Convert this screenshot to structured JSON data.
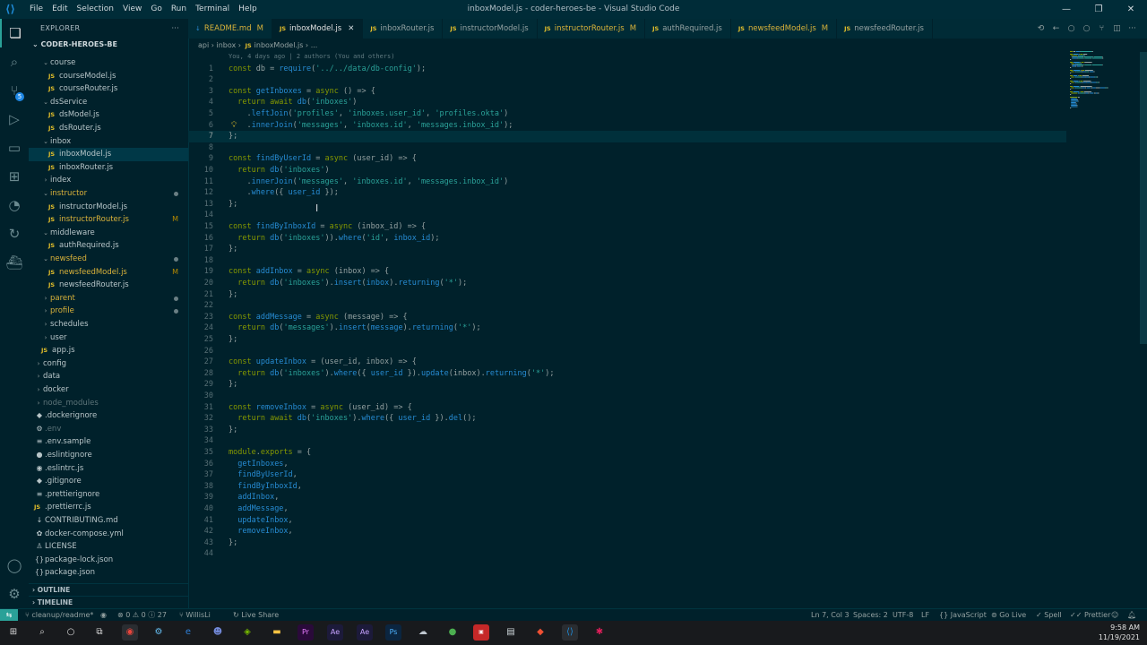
{
  "window": {
    "title": "inboxModel.js - coder-heroes-be - Visual Studio Code",
    "menu": [
      "File",
      "Edit",
      "Selection",
      "View",
      "Go",
      "Run",
      "Terminal",
      "Help"
    ]
  },
  "sidebar": {
    "header": "EXPLORER",
    "project": "CODER-HEROES-BE",
    "tree": [
      {
        "label": "course",
        "type": "folder",
        "depth": 1,
        "open": true
      },
      {
        "label": "courseModel.js",
        "type": "js",
        "depth": 2
      },
      {
        "label": "courseRouter.js",
        "type": "js",
        "depth": 2
      },
      {
        "label": "dsService",
        "type": "folder",
        "depth": 1,
        "open": true
      },
      {
        "label": "dsModel.js",
        "type": "js",
        "depth": 2
      },
      {
        "label": "dsRouter.js",
        "type": "js",
        "depth": 2
      },
      {
        "label": "inbox",
        "type": "folder",
        "depth": 1,
        "open": true
      },
      {
        "label": "inboxModel.js",
        "type": "js",
        "depth": 2,
        "selected": true
      },
      {
        "label": "inboxRouter.js",
        "type": "js",
        "depth": 2
      },
      {
        "label": "index",
        "type": "folder",
        "depth": 1,
        "open": false
      },
      {
        "label": "instructor",
        "type": "folder",
        "depth": 1,
        "open": true,
        "modified": true,
        "dot": true
      },
      {
        "label": "instructorModel.js",
        "type": "js",
        "depth": 2
      },
      {
        "label": "instructorRouter.js",
        "type": "js",
        "depth": 2,
        "modified": true,
        "marker": "M"
      },
      {
        "label": "middleware",
        "type": "folder",
        "depth": 1,
        "open": true
      },
      {
        "label": "authRequired.js",
        "type": "js",
        "depth": 2
      },
      {
        "label": "newsfeed",
        "type": "folder",
        "depth": 1,
        "open": true,
        "modified": true,
        "dot": true
      },
      {
        "label": "newsfeedModel.js",
        "type": "js",
        "depth": 2,
        "modified": true,
        "marker": "M"
      },
      {
        "label": "newsfeedRouter.js",
        "type": "js",
        "depth": 2
      },
      {
        "label": "parent",
        "type": "folder",
        "depth": 1,
        "open": false,
        "modified": true,
        "dot": true
      },
      {
        "label": "profile",
        "type": "folder",
        "depth": 1,
        "open": false,
        "modified": true,
        "dot": true
      },
      {
        "label": "schedules",
        "type": "folder",
        "depth": 1,
        "open": false
      },
      {
        "label": "user",
        "type": "folder",
        "depth": 1,
        "open": false
      },
      {
        "label": "app.js",
        "type": "js",
        "depth": 1
      },
      {
        "label": "config",
        "type": "folder",
        "depth": 0,
        "open": false
      },
      {
        "label": "data",
        "type": "folder",
        "depth": 0,
        "open": false
      },
      {
        "label": "docker",
        "type": "folder",
        "depth": 0,
        "open": false
      },
      {
        "label": "node_modules",
        "type": "folder",
        "depth": 0,
        "open": false,
        "ignored": true
      },
      {
        "label": ".dockerignore",
        "type": "file",
        "depth": 0,
        "glyph": "◆"
      },
      {
        "label": ".env",
        "type": "file",
        "depth": 0,
        "glyph": "⚙",
        "ignored": true
      },
      {
        "label": ".env.sample",
        "type": "file",
        "depth": 0,
        "glyph": "≡"
      },
      {
        "label": ".eslintignore",
        "type": "file",
        "depth": 0,
        "glyph": "●"
      },
      {
        "label": ".eslintrc.js",
        "type": "file",
        "depth": 0,
        "glyph": "◉"
      },
      {
        "label": ".gitignore",
        "type": "file",
        "depth": 0,
        "glyph": "◆"
      },
      {
        "label": ".prettierignore",
        "type": "file",
        "depth": 0,
        "glyph": "≡"
      },
      {
        "label": ".prettierrc.js",
        "type": "js",
        "depth": 0
      },
      {
        "label": "CONTRIBUTING.md",
        "type": "file",
        "depth": 0,
        "glyph": "↓"
      },
      {
        "label": "docker-compose.yml",
        "type": "file",
        "depth": 0,
        "glyph": "✿"
      },
      {
        "label": "LICENSE",
        "type": "file",
        "depth": 0,
        "glyph": "♙"
      },
      {
        "label": "package-lock.json",
        "type": "file",
        "depth": 0,
        "glyph": "{}"
      },
      {
        "label": "package.json",
        "type": "file",
        "depth": 0,
        "glyph": "{}"
      }
    ],
    "outline": "OUTLINE",
    "timeline": "TIMELINE"
  },
  "tabs": [
    {
      "label": "README.md",
      "kind": "md",
      "marker": "M",
      "modified": true
    },
    {
      "label": "inboxModel.js",
      "kind": "js",
      "active": true,
      "close": "✕"
    },
    {
      "label": "inboxRouter.js",
      "kind": "js"
    },
    {
      "label": "instructorModel.js",
      "kind": "js"
    },
    {
      "label": "instructorRouter.js",
      "kind": "js",
      "marker": "M",
      "modified": true
    },
    {
      "label": "authRequired.js",
      "kind": "js"
    },
    {
      "label": "newsfeedModel.js",
      "kind": "js",
      "marker": "M",
      "modified": true
    },
    {
      "label": "newsfeedRouter.js",
      "kind": "js"
    }
  ],
  "breadcrumb": {
    "parts": [
      "api",
      "inbox",
      "inboxModel.js",
      "..."
    ]
  },
  "blame": "You, 4 days ago | 2 authors (You and others)",
  "code": {
    "lines": [
      [
        [
          "kw",
          "const "
        ],
        [
          "pl",
          "db = "
        ],
        [
          "fn",
          "require"
        ],
        [
          "pl",
          "("
        ],
        [
          "str",
          "'../../data/db-config'"
        ],
        [
          "pl",
          ");"
        ]
      ],
      [],
      [
        [
          "kw",
          "const "
        ],
        [
          "fn",
          "getInboxes"
        ],
        [
          "pl",
          " = "
        ],
        [
          "kw",
          "async "
        ],
        [
          "pl",
          "() => {"
        ]
      ],
      [
        [
          "pl",
          "  "
        ],
        [
          "kw",
          "return await "
        ],
        [
          "fn",
          "db"
        ],
        [
          "pl",
          "("
        ],
        [
          "str",
          "'inboxes'"
        ],
        [
          "pl",
          ")"
        ]
      ],
      [
        [
          "pl",
          "    ."
        ],
        [
          "fn",
          "leftJoin"
        ],
        [
          "pl",
          "("
        ],
        [
          "str",
          "'profiles'"
        ],
        [
          "pl",
          ", "
        ],
        [
          "str",
          "'inboxes.user_id'"
        ],
        [
          "pl",
          ", "
        ],
        [
          "str",
          "'profiles.okta'"
        ],
        [
          "pl",
          ")"
        ]
      ],
      [
        [
          "pl",
          "    ."
        ],
        [
          "fn",
          "innerJoin"
        ],
        [
          "pl",
          "("
        ],
        [
          "str",
          "'messages'"
        ],
        [
          "pl",
          ", "
        ],
        [
          "str",
          "'inboxes.id'"
        ],
        [
          "pl",
          ", "
        ],
        [
          "str",
          "'messages.inbox_id'"
        ],
        [
          "pl",
          ");"
        ]
      ],
      [
        [
          "pl",
          "};"
        ]
      ],
      [],
      [
        [
          "kw",
          "const "
        ],
        [
          "fn",
          "findByUserId"
        ],
        [
          "pl",
          " = "
        ],
        [
          "kw",
          "async "
        ],
        [
          "pl",
          "(user_id) => {"
        ]
      ],
      [
        [
          "pl",
          "  "
        ],
        [
          "kw",
          "return "
        ],
        [
          "fn",
          "db"
        ],
        [
          "pl",
          "("
        ],
        [
          "str",
          "'inboxes'"
        ],
        [
          "pl",
          ")"
        ]
      ],
      [
        [
          "pl",
          "    ."
        ],
        [
          "fn",
          "innerJoin"
        ],
        [
          "pl",
          "("
        ],
        [
          "str",
          "'messages'"
        ],
        [
          "pl",
          ", "
        ],
        [
          "str",
          "'inboxes.id'"
        ],
        [
          "pl",
          ", "
        ],
        [
          "str",
          "'messages.inbox_id'"
        ],
        [
          "pl",
          ")"
        ]
      ],
      [
        [
          "pl",
          "    ."
        ],
        [
          "fn",
          "where"
        ],
        [
          "pl",
          "({ "
        ],
        [
          "fn",
          "user_id"
        ],
        [
          "pl",
          " });"
        ]
      ],
      [
        [
          "pl",
          "};"
        ]
      ],
      [],
      [
        [
          "kw",
          "const "
        ],
        [
          "fn",
          "findByInboxId"
        ],
        [
          "pl",
          " = "
        ],
        [
          "kw",
          "async "
        ],
        [
          "pl",
          "(inbox_id) => {"
        ]
      ],
      [
        [
          "pl",
          "  "
        ],
        [
          "kw",
          "return "
        ],
        [
          "fn",
          "db"
        ],
        [
          "pl",
          "("
        ],
        [
          "str",
          "'inboxes'"
        ],
        [
          "pl",
          "))."
        ],
        [
          "fn",
          "where"
        ],
        [
          "pl",
          "("
        ],
        [
          "str",
          "'id'"
        ],
        [
          "pl",
          ", "
        ],
        [
          "fn",
          "inbox_id"
        ],
        [
          "pl",
          ");"
        ]
      ],
      [
        [
          "pl",
          "};"
        ]
      ],
      [],
      [
        [
          "kw",
          "const "
        ],
        [
          "fn",
          "addInbox"
        ],
        [
          "pl",
          " = "
        ],
        [
          "kw",
          "async "
        ],
        [
          "pl",
          "(inbox) => {"
        ]
      ],
      [
        [
          "pl",
          "  "
        ],
        [
          "kw",
          "return "
        ],
        [
          "fn",
          "db"
        ],
        [
          "pl",
          "("
        ],
        [
          "str",
          "'inboxes'"
        ],
        [
          "pl",
          ")."
        ],
        [
          "fn",
          "insert"
        ],
        [
          "pl",
          "("
        ],
        [
          "fn",
          "inbox"
        ],
        [
          "pl",
          ")."
        ],
        [
          "fn",
          "returning"
        ],
        [
          "pl",
          "("
        ],
        [
          "str",
          "'*'"
        ],
        [
          "pl",
          ");"
        ]
      ],
      [
        [
          "pl",
          "};"
        ]
      ],
      [],
      [
        [
          "kw",
          "const "
        ],
        [
          "fn",
          "addMessage"
        ],
        [
          "pl",
          " = "
        ],
        [
          "kw",
          "async "
        ],
        [
          "pl",
          "(message) => {"
        ]
      ],
      [
        [
          "pl",
          "  "
        ],
        [
          "kw",
          "return "
        ],
        [
          "fn",
          "db"
        ],
        [
          "pl",
          "("
        ],
        [
          "str",
          "'messages'"
        ],
        [
          "pl",
          ")."
        ],
        [
          "fn",
          "insert"
        ],
        [
          "pl",
          "("
        ],
        [
          "fn",
          "message"
        ],
        [
          "pl",
          ")."
        ],
        [
          "fn",
          "returning"
        ],
        [
          "pl",
          "("
        ],
        [
          "str",
          "'*'"
        ],
        [
          "pl",
          ");"
        ]
      ],
      [
        [
          "pl",
          "};"
        ]
      ],
      [],
      [
        [
          "kw",
          "const "
        ],
        [
          "fn",
          "updateInbox"
        ],
        [
          "pl",
          " = "
        ],
        [
          "kw",
          ""
        ],
        [
          "pl",
          "(user_id, inbox) => {"
        ]
      ],
      [
        [
          "pl",
          "  "
        ],
        [
          "kw",
          "return "
        ],
        [
          "fn",
          "db"
        ],
        [
          "pl",
          "("
        ],
        [
          "str",
          "'inboxes'"
        ],
        [
          "pl",
          ")."
        ],
        [
          "fn",
          "where"
        ],
        [
          "pl",
          "({ "
        ],
        [
          "fn",
          "user_id"
        ],
        [
          "pl",
          " })."
        ],
        [
          "fn",
          "update"
        ],
        [
          "pl",
          "(inbox)."
        ],
        [
          "fn",
          "returning"
        ],
        [
          "pl",
          "("
        ],
        [
          "str",
          "'*'"
        ],
        [
          "pl",
          ");"
        ]
      ],
      [
        [
          "pl",
          "};"
        ]
      ],
      [],
      [
        [
          "kw",
          "const "
        ],
        [
          "fn",
          "removeInbox"
        ],
        [
          "pl",
          " = "
        ],
        [
          "kw",
          "async "
        ],
        [
          "pl",
          "(user_id) => {"
        ]
      ],
      [
        [
          "pl",
          "  "
        ],
        [
          "kw",
          "return await "
        ],
        [
          "fn",
          "db"
        ],
        [
          "pl",
          "("
        ],
        [
          "str",
          "'inboxes'"
        ],
        [
          "pl",
          ")."
        ],
        [
          "fn",
          "where"
        ],
        [
          "pl",
          "({ "
        ],
        [
          "fn",
          "user_id"
        ],
        [
          "pl",
          " })."
        ],
        [
          "fn",
          "del"
        ],
        [
          "pl",
          "();"
        ]
      ],
      [
        [
          "pl",
          "};"
        ]
      ],
      [],
      [
        [
          "kw",
          "module"
        ],
        [
          "pl",
          "."
        ],
        [
          "kw",
          "exports"
        ],
        [
          "pl",
          " = {"
        ]
      ],
      [
        [
          "pl",
          "  "
        ],
        [
          "fn",
          "getInboxes"
        ],
        [
          "pl",
          ","
        ]
      ],
      [
        [
          "pl",
          "  "
        ],
        [
          "fn",
          "findByUserId"
        ],
        [
          "pl",
          ","
        ]
      ],
      [
        [
          "pl",
          "  "
        ],
        [
          "fn",
          "findByInboxId"
        ],
        [
          "pl",
          ","
        ]
      ],
      [
        [
          "pl",
          "  "
        ],
        [
          "fn",
          "addInbox"
        ],
        [
          "pl",
          ","
        ]
      ],
      [
        [
          "pl",
          "  "
        ],
        [
          "fn",
          "addMessage"
        ],
        [
          "pl",
          ","
        ]
      ],
      [
        [
          "pl",
          "  "
        ],
        [
          "fn",
          "updateInbox"
        ],
        [
          "pl",
          ","
        ]
      ],
      [
        [
          "pl",
          "  "
        ],
        [
          "fn",
          "removeInbox"
        ],
        [
          "pl",
          ","
        ]
      ],
      [
        [
          "pl",
          "};"
        ]
      ],
      []
    ],
    "current_line": 7,
    "lightbulb_line": 6
  },
  "statusbar": {
    "branch": "cleanup/readme*",
    "errors": "0",
    "warnings": "0",
    "info": "27",
    "author": "WillisLi",
    "live_share": "Live Share",
    "position": "Ln 7, Col 3",
    "spaces": "Spaces: 2",
    "encoding": "UTF-8",
    "eol": "LF",
    "language": "JavaScript",
    "go_live": "Go Live",
    "spell": "Spell",
    "prettier": "Prettier"
  },
  "taskbar": {
    "time": "9:58 AM",
    "date": "11/19/2021"
  },
  "colors": {
    "accent": "#2aa198",
    "keyword": "#859900",
    "function": "#268bd2",
    "string": "#2aa198",
    "modified": "#d8b23a"
  }
}
